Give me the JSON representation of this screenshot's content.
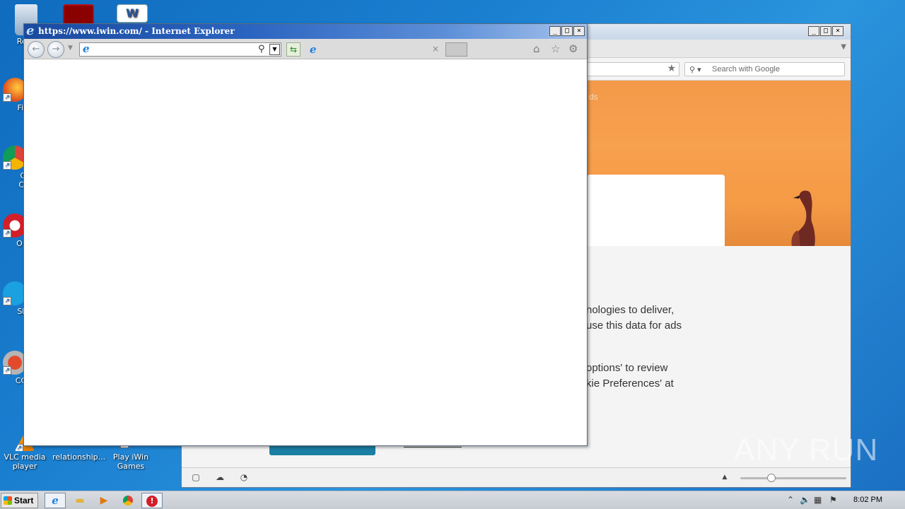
{
  "desktop": {
    "icons": [
      {
        "label": "Recy"
      },
      {
        "label": "Fir"
      },
      {
        "label": "Go Chr"
      },
      {
        "label": "Op"
      },
      {
        "label": "Sk"
      },
      {
        "label": "CCl"
      },
      {
        "label": "VLC media player"
      },
      {
        "label": "relationship..."
      },
      {
        "label": "Play iWin Games"
      }
    ]
  },
  "firefox_window": {
    "search_placeholder": "Search with Google",
    "hero_faint_text": "ds",
    "cookie_text": [
      "nologies to deliver,",
      "use this data for ads",
      "options' to review",
      "kie Preferences' at"
    ]
  },
  "ie_window": {
    "title": "https://www.iwin.com/ - Internet Explorer",
    "address_value": "",
    "tab_title": ""
  },
  "taskbar": {
    "start_label": "Start",
    "clock": "8:02 PM"
  },
  "watermark": "ANY RUN"
}
